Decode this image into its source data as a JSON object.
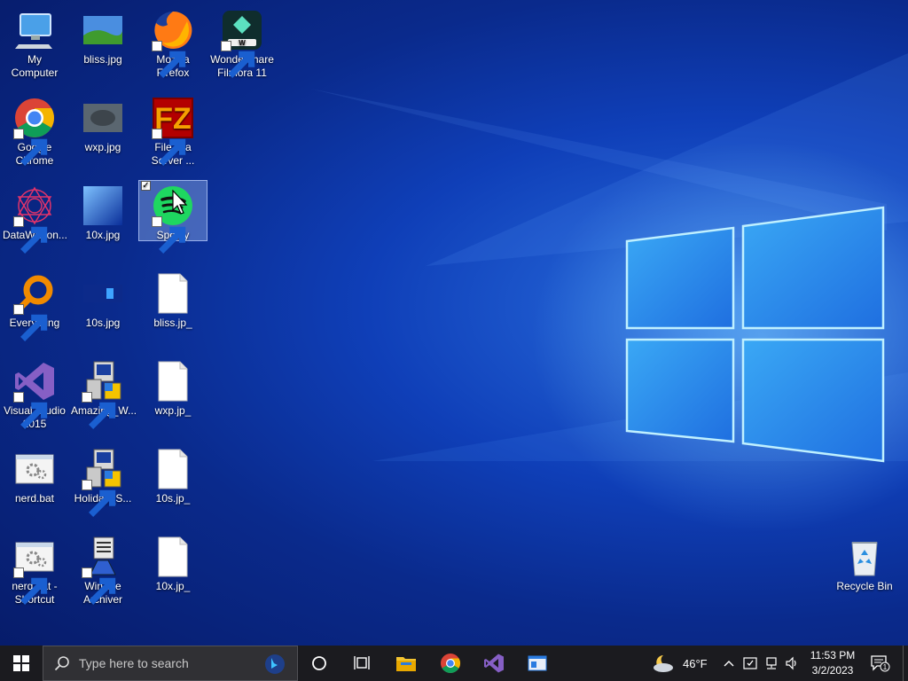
{
  "desktop": {
    "icons": [
      {
        "id": "my-computer",
        "label": "My Computer"
      },
      {
        "id": "bliss-jpg",
        "label": "bliss.jpg"
      },
      {
        "id": "firefox",
        "label": "Mozilla Firefox"
      },
      {
        "id": "filmora",
        "label": "Wondershare Filmora 11"
      },
      {
        "id": "chrome",
        "label": "Google Chrome"
      },
      {
        "id": "wxp-jpg",
        "label": "wxp.jpg"
      },
      {
        "id": "filezilla",
        "label": "FileZilla Server ..."
      },
      {
        "id": "datawagon",
        "label": "DataWagon..."
      },
      {
        "id": "10x-jpg",
        "label": "10x.jpg"
      },
      {
        "id": "spotify",
        "label": "Spotify"
      },
      {
        "id": "everything",
        "label": "Everything"
      },
      {
        "id": "10s-jpg",
        "label": "10s.jpg"
      },
      {
        "id": "bliss-jp_",
        "label": "bliss.jp_"
      },
      {
        "id": "visual-studio",
        "label": "Visual Studio 2015"
      },
      {
        "id": "amazing",
        "label": "Amazing_W..."
      },
      {
        "id": "wxp-jp_",
        "label": "wxp.jp_"
      },
      {
        "id": "nerd-bat",
        "label": "nerd.bat"
      },
      {
        "id": "holiday",
        "label": "Holiday_S..."
      },
      {
        "id": "10s-jp_",
        "label": "10s.jp_"
      },
      {
        "id": "nerd-bat-shortcut",
        "label": "nerd.bat - Shortcut"
      },
      {
        "id": "winace",
        "label": "WinAce Archiver"
      },
      {
        "id": "10x-jp_",
        "label": "10x.jp_"
      },
      {
        "id": "recycle-bin",
        "label": "Recycle Bin"
      }
    ]
  },
  "taskbar": {
    "search_placeholder": "Type here to search",
    "weather": "46°F",
    "time": "11:53 PM",
    "date": "3/2/2023",
    "notification_count": "1"
  },
  "colors": {
    "taskbar_bg": "#1b1b1f",
    "selection": "#8caae6"
  }
}
